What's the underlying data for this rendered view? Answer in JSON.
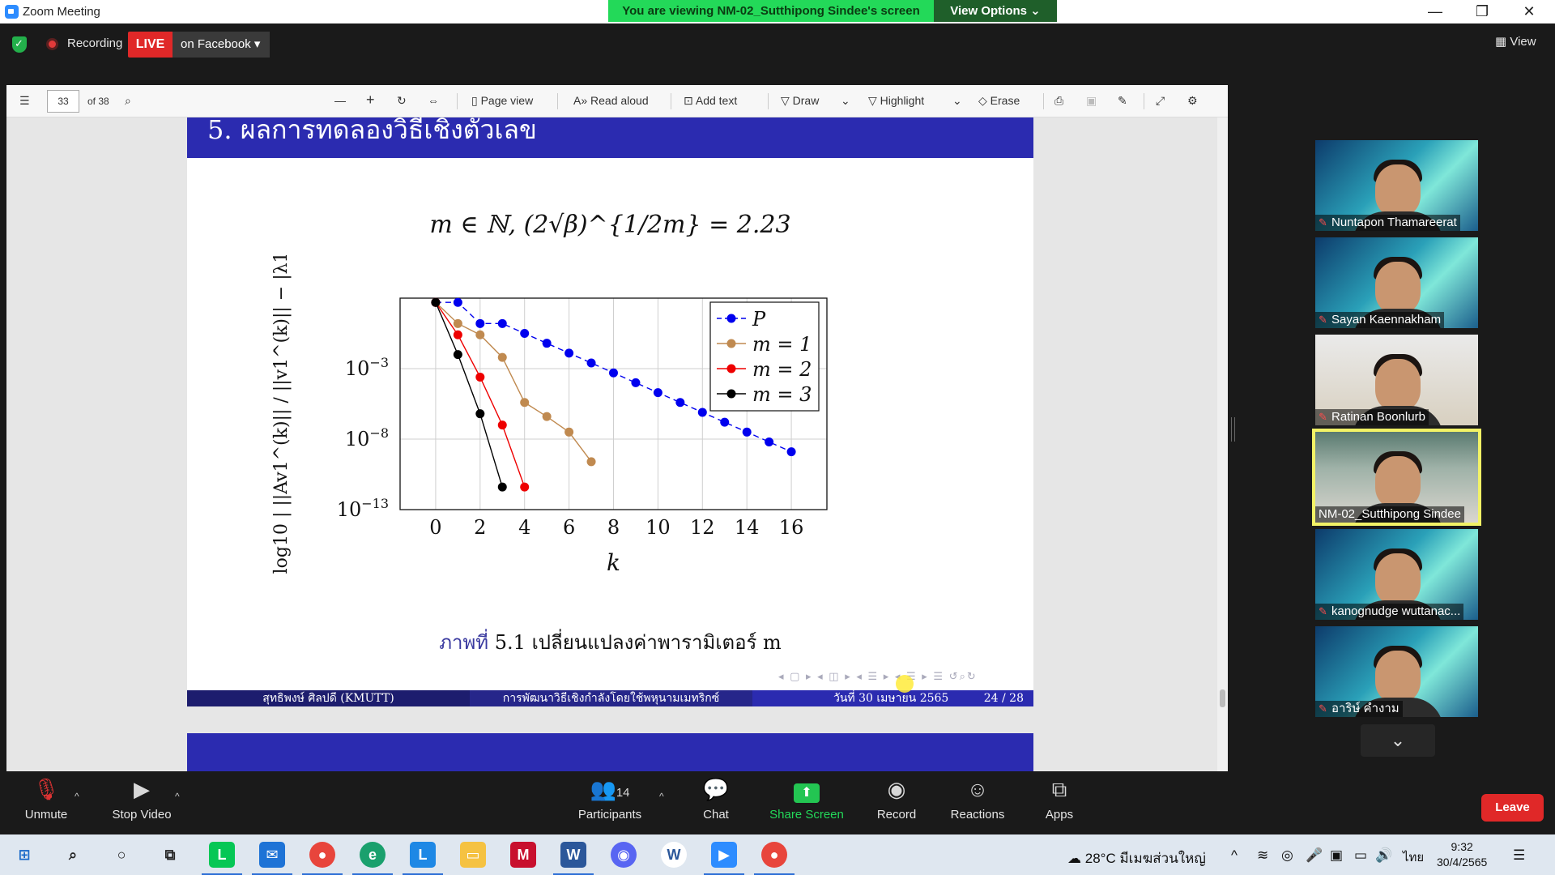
{
  "window": {
    "title": "Zoom Meeting"
  },
  "share_banner": {
    "text": "You are viewing NM-02_Sutthipong Sindee's screen",
    "view_options": "View Options ⌄"
  },
  "top_bar": {
    "recording_label": "Recording",
    "live_badge": "LIVE",
    "live_target": "on Facebook ▾",
    "view_label": "View"
  },
  "pdf_toolbar": {
    "page_number": "33",
    "page_total": "of 38",
    "zoom_out": "—",
    "zoom_in": "+",
    "page_view": "Page view",
    "read_aloud": "Read aloud",
    "add_text": "Add text",
    "draw": "Draw",
    "highlight": "Highlight",
    "erase": "Erase"
  },
  "slide": {
    "header": "5. ผลการทดลองวิธีเชิงตัวเลข",
    "formula": "m ∈ ℕ, (2√β)^{1/2m} = 2.23",
    "caption_label": "ภาพที่",
    "caption_text": "5.1 เปลี่ยนแปลงค่าพารามิเตอร์ m",
    "footer_author": "สุทธิพงษ์ ศิลปดี (KMUTT)",
    "footer_title": "การพัฒนาวิธีเชิงกำลังโดยใช้พหุนามเมทริกซ์",
    "footer_date": "วันที่ 30 เมษายน 2565",
    "footer_page": "24 / 28"
  },
  "chart_data": {
    "type": "line",
    "title": "",
    "xlabel": "k",
    "ylabel": "log10 | ||Av1^(k)|| / ||v1^(k)|| − |λ1| |",
    "y_scale": "log10",
    "xlim": [
      -1.6,
      17.6
    ],
    "ylim": [
      -13.0,
      2.0
    ],
    "x_ticks": [
      "0",
      "2",
      "4",
      "6",
      "8",
      "10",
      "12",
      "14",
      "16"
    ],
    "y_ticks": [
      "10^-3",
      "10^-8",
      "10^-13"
    ],
    "grid": true,
    "legend_position": "top-right",
    "series": [
      {
        "name": "P",
        "color": "#0000ee",
        "dash": true,
        "x": [
          0,
          1,
          2,
          3,
          4,
          5,
          6,
          7,
          8,
          9,
          10,
          11,
          12,
          13,
          14,
          15,
          16
        ],
        "y": [
          1.7,
          1.7,
          0.2,
          0.2,
          -0.5,
          -1.2,
          -1.9,
          -2.6,
          -3.3,
          -4.0,
          -4.7,
          -5.4,
          -6.1,
          -6.8,
          -7.5,
          -8.2,
          -8.9
        ]
      },
      {
        "name": "m = 1",
        "color": "#c08a50",
        "dash": false,
        "x": [
          0,
          1,
          2,
          3,
          4,
          5,
          6,
          7
        ],
        "y": [
          1.7,
          0.2,
          -0.6,
          -2.2,
          -5.4,
          -6.4,
          -7.5,
          -9.6
        ]
      },
      {
        "name": "m = 2",
        "color": "#ee0000",
        "dash": false,
        "x": [
          0,
          1,
          2,
          3,
          4
        ],
        "y": [
          1.7,
          -0.6,
          -3.6,
          -7.0,
          -11.4
        ]
      },
      {
        "name": "m = 3",
        "color": "#000000",
        "dash": false,
        "x": [
          0,
          1,
          2,
          3
        ],
        "y": [
          1.7,
          -2.0,
          -6.2,
          -11.4
        ]
      }
    ]
  },
  "participants": [
    {
      "name": "Nuntapon Thamareerat",
      "muted": true
    },
    {
      "name": "Sayan Kaennakham",
      "muted": true
    },
    {
      "name": "Ratinan Boonlurb",
      "muted": true
    },
    {
      "name": "NM-02_Sutthipong Sindee",
      "muted": false,
      "active": true
    },
    {
      "name": "kanognudge wuttanac...",
      "muted": true
    },
    {
      "name": "อาริษ์ คำงาม",
      "muted": true
    }
  ],
  "controls": {
    "unmute": "Unmute",
    "stop_video": "Stop Video",
    "participants": "Participants",
    "participants_count": "14",
    "chat": "Chat",
    "share_screen": "Share Screen",
    "record": "Record",
    "reactions": "Reactions",
    "apps": "Apps",
    "leave": "Leave"
  },
  "taskbar": {
    "weather": "28°C มีเมฆส่วนใหญ่",
    "lang": "ไทย",
    "time": "9:32",
    "date": "30/4/2565"
  },
  "colors": {
    "zoom_blue": "#2d8cff",
    "live_red": "#e02828",
    "share_green": "#23c552",
    "slide_blue": "#2b2bb0"
  }
}
